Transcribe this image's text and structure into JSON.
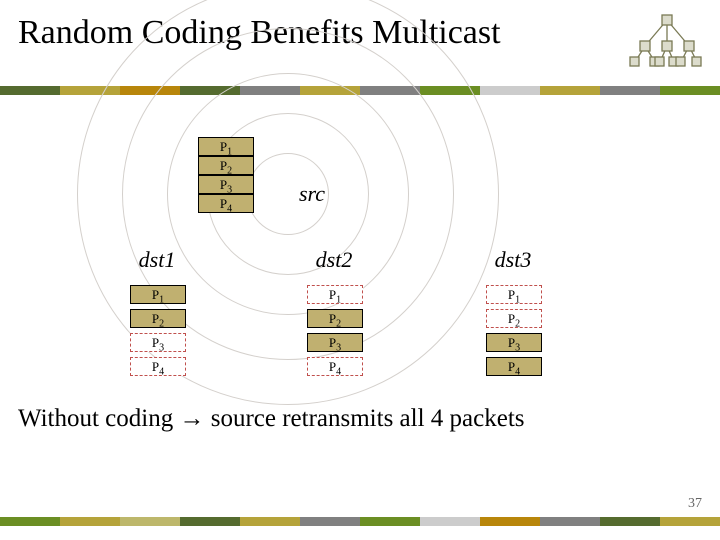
{
  "title": "Random Coding Benefits Multicast",
  "labels": {
    "src": "src",
    "dst1": "dst1",
    "dst2": "dst2",
    "dst3": "dst3"
  },
  "packets": {
    "p1": "P1",
    "p2": "P2",
    "p3": "P3",
    "p4": "P4"
  },
  "statement": "Without coding → source retransmits all 4 packets",
  "page_number": "37",
  "loss": {
    "dst1": [
      false,
      false,
      true,
      true
    ],
    "dst2": [
      true,
      false,
      false,
      true
    ],
    "dst3": [
      true,
      true,
      false,
      false
    ]
  },
  "palette": {
    "top": [
      "#556b2f",
      "#b5a33a",
      "#b8860b",
      "#556b2f",
      "#808080",
      "#b5a33a",
      "#808080",
      "#6b8e23",
      "#cccccc",
      "#b5a33a",
      "#808080",
      "#6b8e23"
    ],
    "bottom": [
      "#6b8e23",
      "#b5a33a",
      "#bdb76b",
      "#556b2f",
      "#b5a33a",
      "#808080",
      "#6b8e23",
      "#cccccc",
      "#b8860b",
      "#808080",
      "#556b2f",
      "#b5a33a"
    ]
  }
}
